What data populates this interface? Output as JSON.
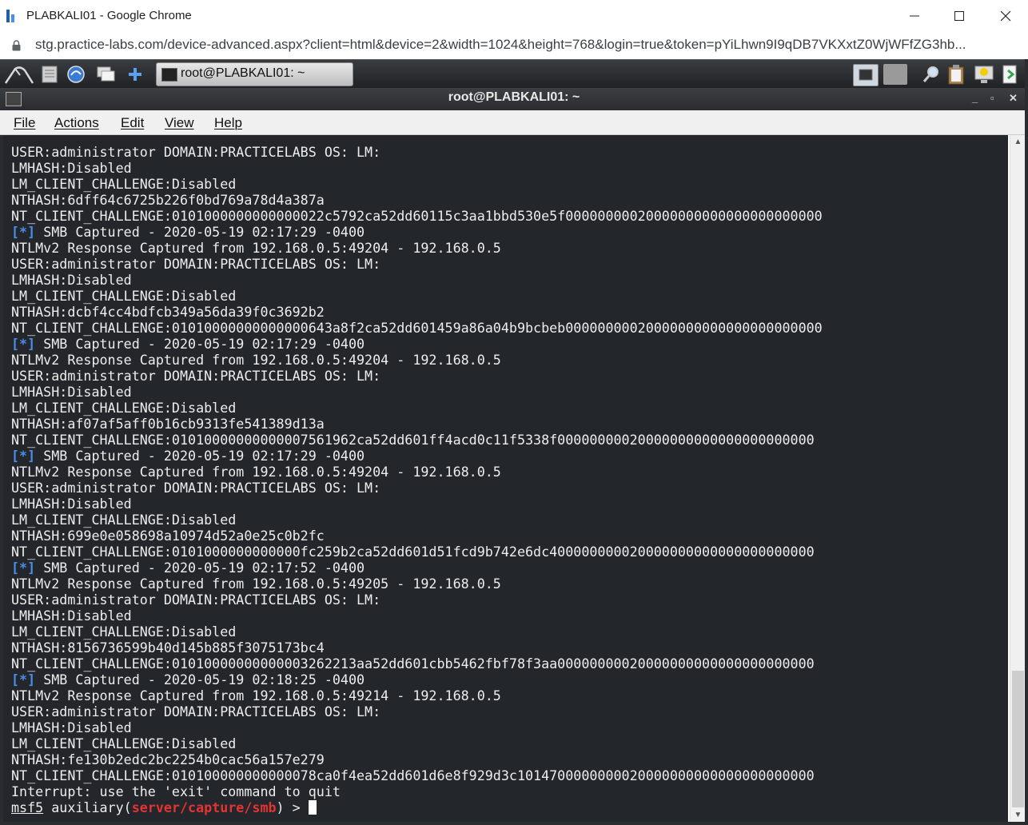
{
  "browser": {
    "window_title": "PLABKALI01 - Google Chrome",
    "url": "stg.practice-labs.com/device-advanced.aspx?client=html&device=2&width=1024&height=768&login=true&token=pYiLhwn9I9qDB7VKXxtZ0WjWFfZG3hb..."
  },
  "desktop": {
    "task_label": "root@PLABKALI01: ~"
  },
  "terminal": {
    "title": "root@PLABKALI01: ~",
    "menu": [
      "File",
      "Actions",
      "Edit",
      "View",
      "Help"
    ],
    "lines": [
      "USER:administrator DOMAIN:PRACTICELABS OS: LM:",
      "LMHASH:Disabled",
      "LM_CLIENT_CHALLENGE:Disabled",
      "NTHASH:6dff64c6725b226f0bd769a78d4a387a",
      "NT_CLIENT_CHALLENGE:0101000000000000022c5792ca52dd60115c3aa1bbd530e5f00000000020000000000000000000000",
      "SMB Captured - 2020-05-19 02:17:29 -0400",
      "NTLMv2 Response Captured from 192.168.0.5:49204 - 192.168.0.5",
      "USER:administrator DOMAIN:PRACTICELABS OS: LM:",
      "LMHASH:Disabled",
      "LM_CLIENT_CHALLENGE:Disabled",
      "NTHASH:dcbf4cc4bdfcb349a56da39f0c3692b2",
      "NT_CLIENT_CHALLENGE:01010000000000000643a8f2ca52dd601459a86a04b9bcbeb00000000020000000000000000000000",
      "SMB Captured - 2020-05-19 02:17:29 -0400",
      "NTLMv2 Response Captured from 192.168.0.5:49204 - 192.168.0.5",
      "USER:administrator DOMAIN:PRACTICELABS OS: LM:",
      "LMHASH:Disabled",
      "LM_CLIENT_CHALLENGE:Disabled",
      "NTHASH:af07af5aff0b16cb9313fe541389d13a",
      "NT_CLIENT_CHALLENGE:01010000000000007561962ca52dd601ff4acd0c11f5338f00000000020000000000000000000000",
      "SMB Captured - 2020-05-19 02:17:29 -0400",
      "NTLMv2 Response Captured from 192.168.0.5:49204 - 192.168.0.5",
      "USER:administrator DOMAIN:PRACTICELABS OS: LM:",
      "LMHASH:Disabled",
      "LM_CLIENT_CHALLENGE:Disabled",
      "NTHASH:699e0e058698a10974d52a0e25c0b2fc",
      "NT_CLIENT_CHALLENGE:0101000000000000fc259b2ca52dd601d51fcd9b742e6dc400000000020000000000000000000000",
      "SMB Captured - 2020-05-19 02:17:52 -0400",
      "NTLMv2 Response Captured from 192.168.0.5:49205 - 192.168.0.5",
      "USER:administrator DOMAIN:PRACTICELABS OS: LM:",
      "LMHASH:Disabled",
      "LM_CLIENT_CHALLENGE:Disabled",
      "NTHASH:8156736599b40d145b885f3075173bc4",
      "NT_CLIENT_CHALLENGE:01010000000000003262213aa52dd601cbb5462fbf78f3aa00000000020000000000000000000000",
      "SMB Captured - 2020-05-19 02:18:25 -0400",
      "NTLMv2 Response Captured from 192.168.0.5:49214 - 192.168.0.5",
      "USER:administrator DOMAIN:PRACTICELABS OS: LM:",
      "LMHASH:Disabled",
      "LM_CLIENT_CHALLENGE:Disabled",
      "NTHASH:fe130b2edc2bc2254b0cac56a157e279",
      "NT_CLIENT_CHALLENGE:010100000000000078ca0f4ea52dd601d6e8f929d3c1014700000000020000000000000000000000",
      "Interrupt: use the 'exit' command to quit"
    ],
    "tagged_line_indexes": [
      5,
      12,
      19,
      26,
      33
    ],
    "tag": "[*]",
    "prompt": {
      "name": "msf5",
      "middle": " auxiliary(",
      "module": "server/capture/smb",
      "end": ") > "
    }
  },
  "colors": {
    "terminal_bg": "#23262b",
    "tag": "#4a8ee8",
    "module": "#e33333"
  }
}
